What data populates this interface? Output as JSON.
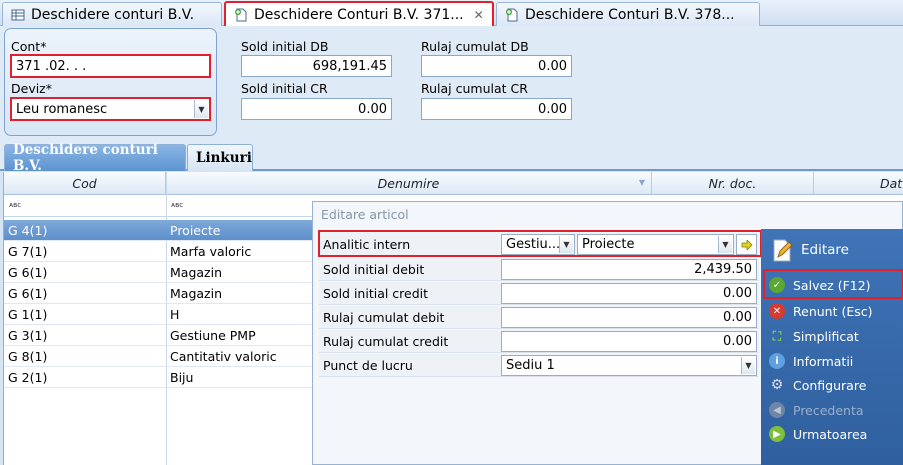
{
  "tabs": [
    {
      "label": "Deschidere conturi B.V."
    },
    {
      "label": "Deschidere Conturi B.V. 371...",
      "close": "✕"
    },
    {
      "label": "Deschidere Conturi B.V. 378..."
    }
  ],
  "header": {
    "cont_label": "Cont*",
    "cont_value": "371 .02.  .  .",
    "deviz_label": "Deviz*",
    "deviz_value": "Leu romanesc",
    "sold_initial_db_label": "Sold initial DB",
    "sold_initial_db_value": "698,191.45",
    "sold_initial_cr_label": "Sold initial CR",
    "sold_initial_cr_value": "0.00",
    "rulaj_cumulat_db_label": "Rulaj cumulat DB",
    "rulaj_cumulat_db_value": "0.00",
    "rulaj_cumulat_cr_label": "Rulaj cumulat CR",
    "rulaj_cumulat_cr_value": "0.00"
  },
  "subtabs": [
    {
      "label": "Deschidere conturi B.V."
    },
    {
      "label": "Linkuri"
    }
  ],
  "grid": {
    "columns": [
      "Cod",
      "Denumire",
      "Nr. doc.",
      "Dat"
    ],
    "filter_glyph": "ᴀʙc",
    "rows": [
      {
        "cod": "G 4(1)",
        "denumire": "Proiecte"
      },
      {
        "cod": "G 7(1)",
        "denumire": "Marfa valoric"
      },
      {
        "cod": "G 6(1)",
        "denumire": "Magazin"
      },
      {
        "cod": "G 6(1)",
        "denumire": "Magazin"
      },
      {
        "cod": "G 1(1)",
        "denumire": "H"
      },
      {
        "cod": "G 3(1)",
        "denumire": "Gestiune PMP"
      },
      {
        "cod": "G 8(1)",
        "denumire": "Cantitativ valoric"
      },
      {
        "cod": "G 2(1)",
        "denumire": "Biju"
      }
    ]
  },
  "dialog": {
    "title": "Editare articol",
    "analitic_label": "Analitic intern",
    "analitic_part1": "Gestiu...",
    "analitic_part2": "Proiecte",
    "sold_initial_debit_label": "Sold initial debit",
    "sold_initial_debit_value": "2,439.50",
    "sold_initial_credit_label": "Sold initial credit",
    "sold_initial_credit_value": "0.00",
    "rulaj_cumulat_debit_label": "Rulaj cumulat debit",
    "rulaj_cumulat_debit_value": "0.00",
    "rulaj_cumulat_credit_label": "Rulaj cumulat credit",
    "rulaj_cumulat_credit_value": "0.00",
    "punct_lucru_label": "Punct de lucru",
    "punct_lucru_value": "Sediu 1"
  },
  "actions": {
    "editare": "Editare",
    "salvez": "Salvez (F12)",
    "renunt": "Renunt (Esc)",
    "simplificat": "Simplificat",
    "informatii": "Informatii",
    "configurare": "Configurare",
    "precedenta": "Precedenta",
    "urmatoarea": "Urmatoarea"
  },
  "colors": {
    "highlight_red": "#e0202a",
    "selection_blue": "#5d8fcc",
    "side_panel_blue": "#2f5f9e"
  }
}
